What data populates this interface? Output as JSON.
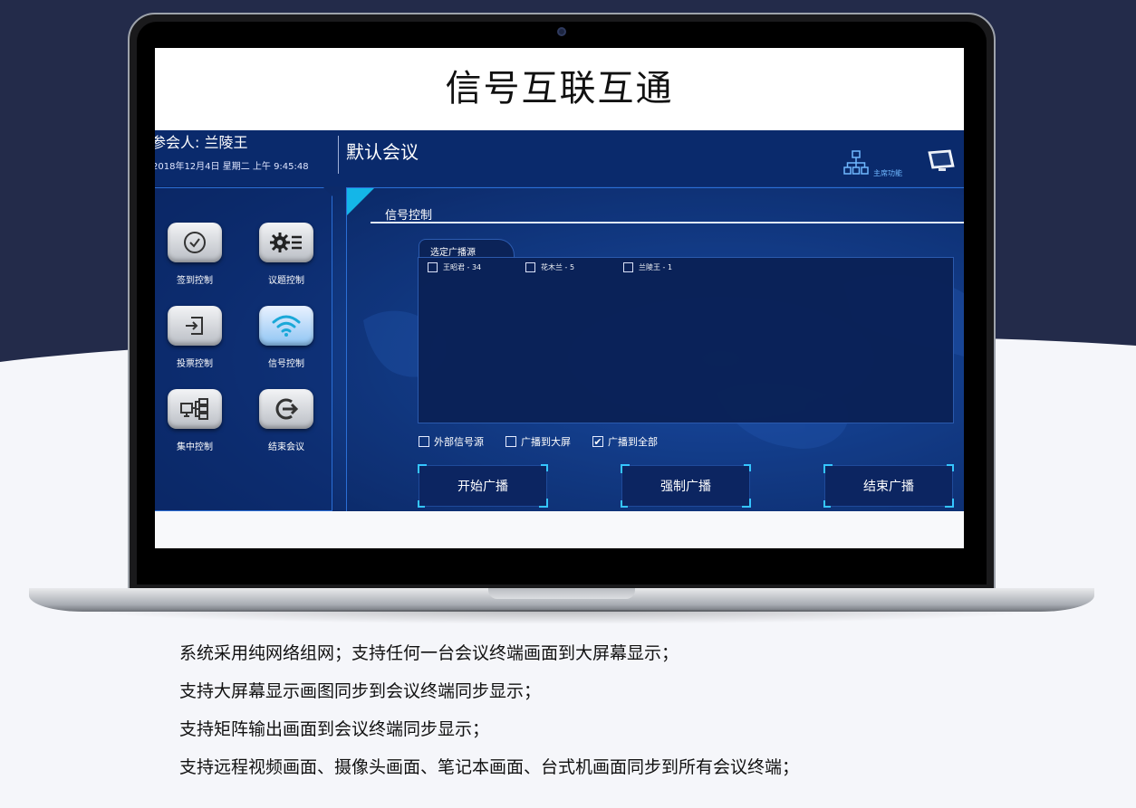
{
  "screen_title": "信号互联互通",
  "app": {
    "participant": "参会人: 兰陵王",
    "date": "2018年12月4日 星期二 上午 9:45:48",
    "meeting_name": "默认会议",
    "host_label": "主席功能"
  },
  "sidebar": {
    "items": [
      {
        "label": "签到控制",
        "icon": "check-icon"
      },
      {
        "label": "议题控制",
        "icon": "settings-list-icon"
      },
      {
        "label": "投票控制",
        "icon": "enter-icon"
      },
      {
        "label": "信号控制",
        "icon": "wifi-icon"
      },
      {
        "label": "集中控制",
        "icon": "network-icon"
      },
      {
        "label": "结束会议",
        "icon": "exit-icon"
      }
    ]
  },
  "signal": {
    "section_title": "信号控制",
    "source_tab": "选定广播源",
    "sources": [
      {
        "label": "王昭君 - 34",
        "checked": false
      },
      {
        "label": "花木兰 - 5",
        "checked": false
      },
      {
        "label": "兰陵王 - 1",
        "checked": false
      }
    ],
    "options": [
      {
        "label": "外部信号源",
        "checked": false
      },
      {
        "label": "广播到大屏",
        "checked": false
      },
      {
        "label": "广播到全部",
        "checked": true
      }
    ],
    "buttons": {
      "start": "开始广播",
      "force": "强制广播",
      "end": "结束广播"
    }
  },
  "descriptions": [
    "系统采用纯网络组网；支持任何一台会议终端画面到大屏幕显示；",
    "支持大屏幕显示画图同步到会议终端同步显示；",
    "支持矩阵输出画面到会议终端同步显示；",
    "支持远程视频画面、摄像头画面、笔记本画面、台式机画面同步到所有会议终端；"
  ],
  "colors": {
    "background_top": "#232b4a",
    "background_bottom": "#f5f6fa",
    "accent": "#14b6e8"
  }
}
